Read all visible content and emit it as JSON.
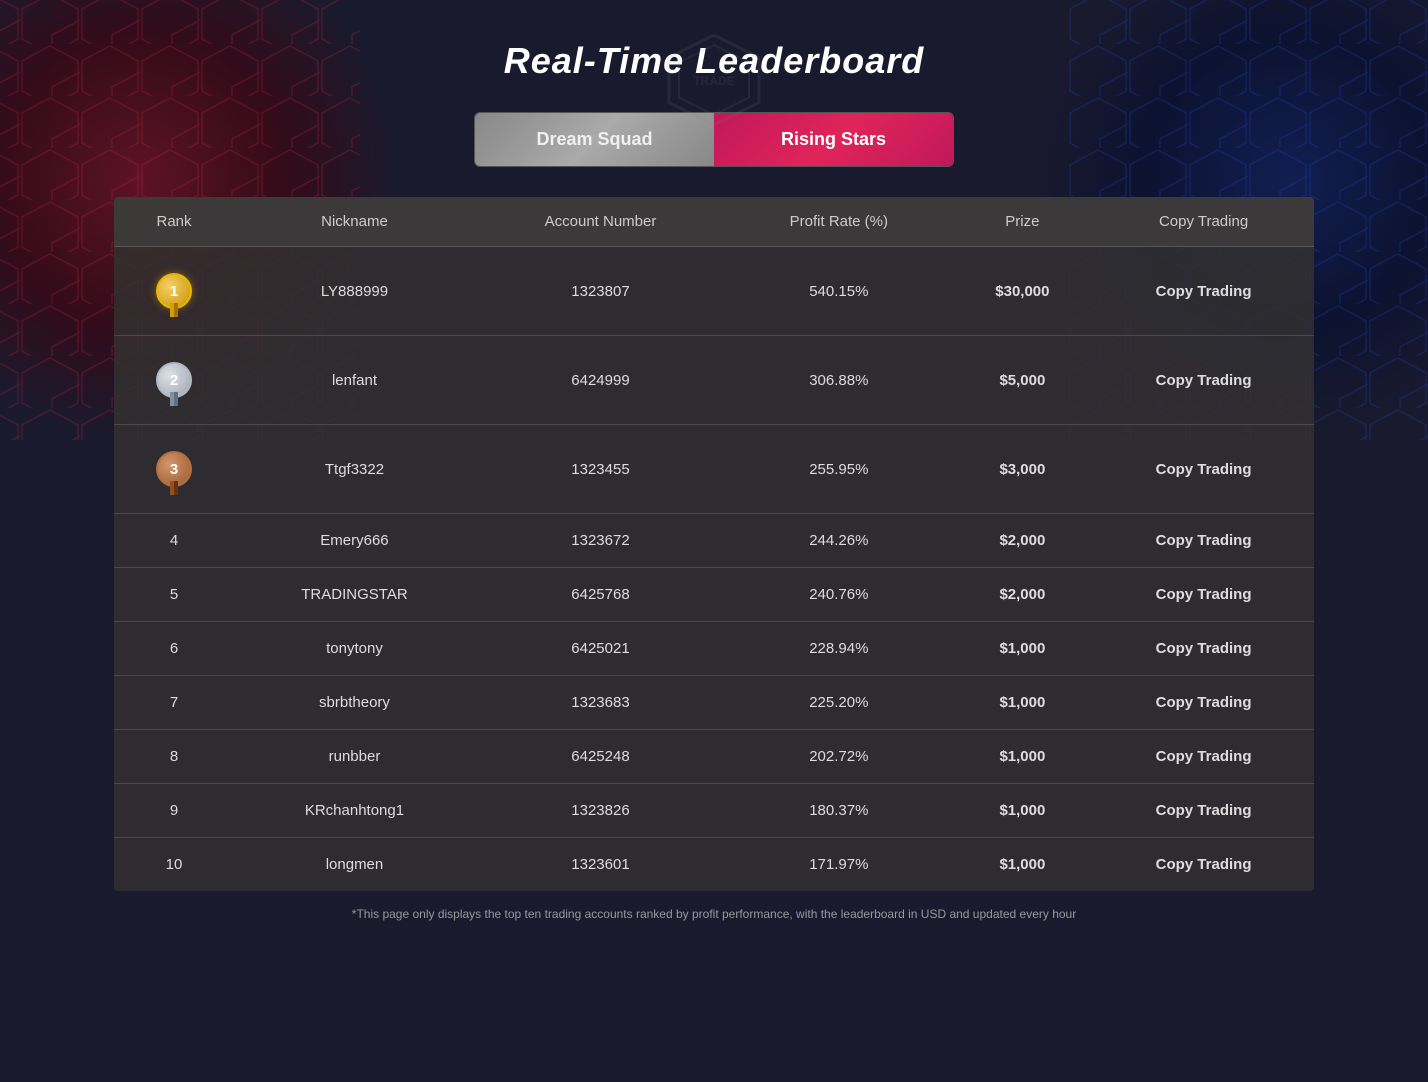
{
  "page": {
    "title": "Real-Time Leaderboard",
    "disclaimer": "*This page only displays the top ten trading accounts ranked by profit performance, with the leaderboard in USD and updated every hour"
  },
  "tabs": [
    {
      "id": "dream-squad",
      "label": "Dream Squad",
      "active": false
    },
    {
      "id": "rising-stars",
      "label": "Rising Stars",
      "active": true
    }
  ],
  "table": {
    "headers": [
      "Rank",
      "Nickname",
      "Account Number",
      "Profit Rate (%)",
      "Prize",
      "Copy Trading"
    ],
    "rows": [
      {
        "rank": "1",
        "nickname": "LY888999",
        "account": "1323807",
        "profit": "540.15%",
        "prize": "$30,000",
        "copyTrading": "Copy Trading"
      },
      {
        "rank": "2",
        "nickname": "lenfant",
        "account": "6424999",
        "profit": "306.88%",
        "prize": "$5,000",
        "copyTrading": "Copy Trading"
      },
      {
        "rank": "3",
        "nickname": "Ttgf3322",
        "account": "1323455",
        "profit": "255.95%",
        "prize": "$3,000",
        "copyTrading": "Copy Trading"
      },
      {
        "rank": "4",
        "nickname": "Emery666",
        "account": "1323672",
        "profit": "244.26%",
        "prize": "$2,000",
        "copyTrading": "Copy Trading"
      },
      {
        "rank": "5",
        "nickname": "TRADINGSTAR",
        "account": "6425768",
        "profit": "240.76%",
        "prize": "$2,000",
        "copyTrading": "Copy Trading"
      },
      {
        "rank": "6",
        "nickname": "tonytony",
        "account": "6425021",
        "profit": "228.94%",
        "prize": "$1,000",
        "copyTrading": "Copy Trading"
      },
      {
        "rank": "7",
        "nickname": "sbrbtheory",
        "account": "1323683",
        "profit": "225.20%",
        "prize": "$1,000",
        "copyTrading": "Copy Trading"
      },
      {
        "rank": "8",
        "nickname": "runbber",
        "account": "6425248",
        "profit": "202.72%",
        "prize": "$1,000",
        "copyTrading": "Copy Trading"
      },
      {
        "rank": "9",
        "nickname": "KRchanhtong1",
        "account": "1323826",
        "profit": "180.37%",
        "prize": "$1,000",
        "copyTrading": "Copy Trading"
      },
      {
        "rank": "10",
        "nickname": "longmen",
        "account": "1323601",
        "profit": "171.97%",
        "prize": "$1,000",
        "copyTrading": "Copy Trading"
      }
    ]
  },
  "colors": {
    "accent_red": "#e05030",
    "active_tab": "#c0185a",
    "inactive_tab": "#888888",
    "medal_gold": "#c8920a",
    "medal_silver": "#9ea5b0",
    "medal_bronze": "#9b5a30"
  }
}
